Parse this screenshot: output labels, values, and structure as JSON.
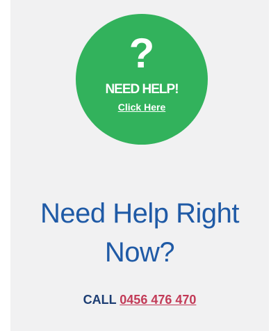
{
  "help_badge": {
    "mark": "?",
    "title": "NEED HELP!",
    "link_label": "Click Here"
  },
  "heading": {
    "line1": "Need Help Right",
    "line2": "Now?"
  },
  "call": {
    "label": "CALL",
    "phone": "0456 476 470"
  },
  "colors": {
    "badge_green": "#32b25c",
    "heading_blue": "#1f5aa6",
    "call_navy": "#1c3d73",
    "phone_red": "#c23a57",
    "panel_bg": "#f1f1f2"
  }
}
